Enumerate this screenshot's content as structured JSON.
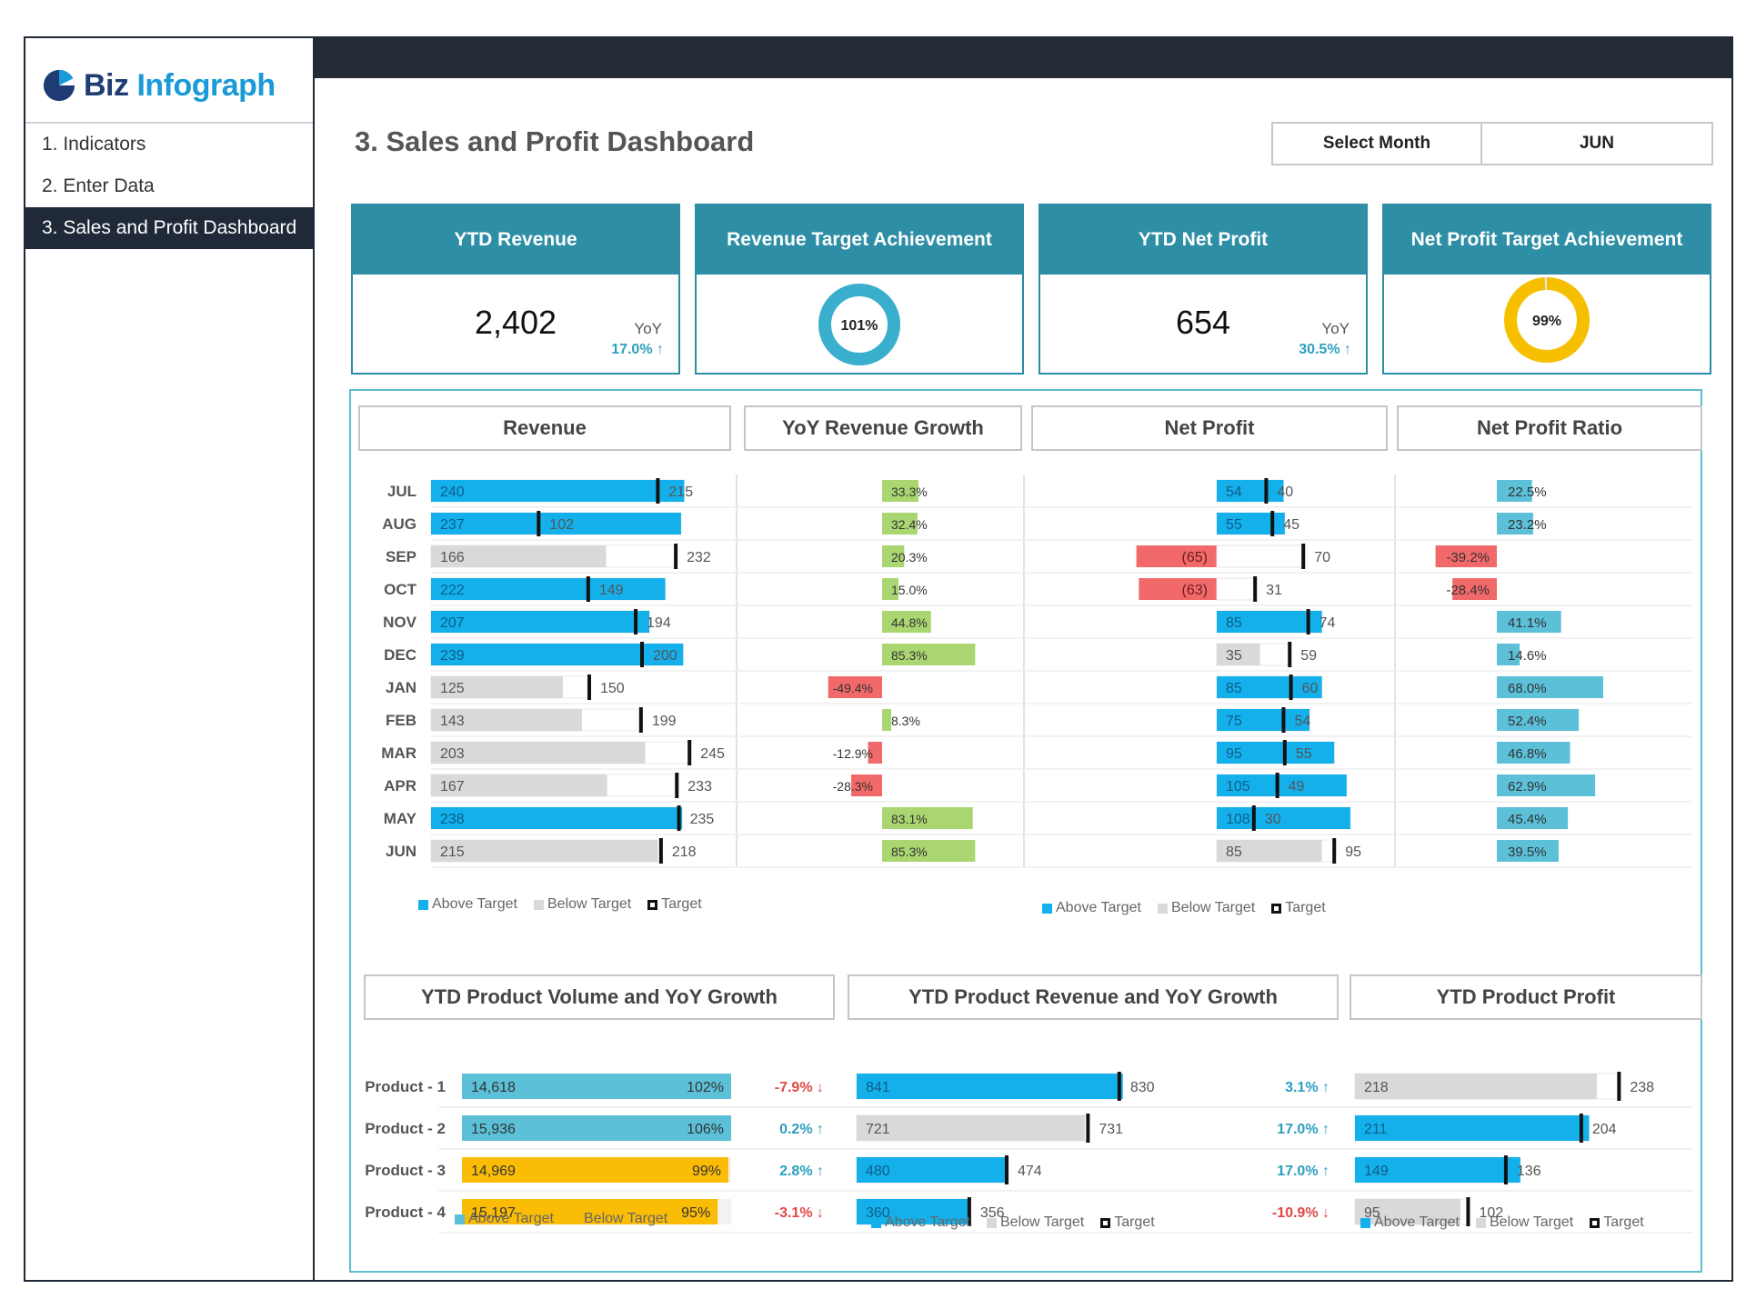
{
  "brand": {
    "biz": "Biz",
    "infograph": "Infograph"
  },
  "sidebar": {
    "items": [
      {
        "label": "1. Indicators",
        "active": false
      },
      {
        "label": "2. Enter Data",
        "active": false
      },
      {
        "label": "3. Sales and Profit Dashboard",
        "active": true
      }
    ]
  },
  "page": {
    "title": "3. Sales and Profit Dashboard"
  },
  "month_select": {
    "label": "Select Month",
    "value": "JUN"
  },
  "kpis": {
    "ytd_revenue": {
      "title": "YTD  Revenue",
      "value": "2,402",
      "yoy_label": "YoY",
      "yoy_value": "17.0% ↑"
    },
    "revenue_target": {
      "title": "Revenue Target Achievement",
      "value": "101%",
      "fraction": 1.0,
      "color": "#3aaecd"
    },
    "ytd_net_profit": {
      "title": "YTD  Net Profit",
      "value": "654",
      "yoy_label": "YoY",
      "yoy_value": "30.5% ↑"
    },
    "profit_target": {
      "title": "Net Profit Target Achievement",
      "value": "99%",
      "fraction": 0.99,
      "color": "#f6c000"
    }
  },
  "sections": {
    "revenue": "Revenue",
    "yoy_growth": "YoY Revenue Growth",
    "net_profit": "Net Profit",
    "net_profit_ratio": "Net Profit Ratio",
    "product_volume": "YTD Product Volume and YoY Growth",
    "product_revenue": "YTD Product Revenue and YoY Growth",
    "product_profit": "YTD Product Profit"
  },
  "legends": {
    "above": "Above Target",
    "below": "Below Target",
    "target": "Target"
  },
  "colors": {
    "above": "#14b0ec",
    "below": "#d9d9d9",
    "teal": "#5bc0d8",
    "yellow": "#fbbc05",
    "green": "#a9d670",
    "red": "#f2696a",
    "up": "#2c9fbf",
    "down": "#e04848"
  },
  "chart_data": [
    {
      "type": "bar",
      "name": "monthly",
      "categories": [
        "JUL",
        "AUG",
        "SEP",
        "OCT",
        "NOV",
        "DEC",
        "JAN",
        "FEB",
        "MAR",
        "APR",
        "MAY",
        "JUN"
      ],
      "revenue": [
        240,
        237,
        166,
        222,
        207,
        239,
        125,
        143,
        203,
        167,
        238,
        215
      ],
      "revenue_target": [
        215,
        102,
        232,
        149,
        194,
        200,
        150,
        199,
        245,
        233,
        235,
        218
      ],
      "revenue_yoy": [
        "33.3%",
        "32.4%",
        "20.3%",
        "15.0%",
        "44.8%",
        "85.3%",
        "-49.4%",
        "8.3%",
        "-12.9%",
        "-28.3%",
        "83.1%",
        "85.3%"
      ],
      "revenue_yoy_values": [
        33.3,
        32.4,
        20.3,
        15.0,
        44.8,
        85.3,
        -49.4,
        8.3,
        -12.9,
        -28.3,
        83.1,
        85.3
      ],
      "net_profit": [
        54,
        55,
        -65,
        -63,
        85,
        35,
        85,
        75,
        95,
        105,
        108,
        85
      ],
      "net_profit_labels": [
        "54",
        "55",
        "(65)",
        "(63)",
        "85",
        "35",
        "85",
        "75",
        "95",
        "105",
        "108",
        "85"
      ],
      "net_profit_target": [
        40,
        45,
        70,
        31,
        74,
        59,
        60,
        54,
        55,
        49,
        30,
        95
      ],
      "net_profit_ratio": [
        "22.5%",
        "23.2%",
        "-39.2%",
        "-28.4%",
        "41.1%",
        "14.6%",
        "68.0%",
        "52.4%",
        "46.8%",
        "62.9%",
        "45.4%",
        "39.5%"
      ],
      "net_profit_ratio_values": [
        22.5,
        23.2,
        -39.2,
        -28.4,
        41.1,
        14.6,
        68.0,
        52.4,
        46.8,
        62.9,
        45.4,
        39.5
      ]
    },
    {
      "type": "bar",
      "name": "products",
      "categories": [
        "Product - 1",
        "Product - 2",
        "Product - 3",
        "Product - 4"
      ],
      "volume": [
        "14,618",
        "15,936",
        "14,969",
        "15,197"
      ],
      "volume_achievement": [
        "102%",
        "106%",
        "99%",
        "95%"
      ],
      "volume_achievement_values": [
        102,
        106,
        99,
        95
      ],
      "volume_yoy": [
        "-7.9% ↓",
        "0.2% ↑",
        "2.8% ↑",
        "-3.1% ↓"
      ],
      "revenue": [
        841,
        721,
        480,
        360
      ],
      "revenue_target": [
        830,
        731,
        474,
        356
      ],
      "revenue_yoy": [
        "3.1% ↑",
        "17.0% ↑",
        "17.0% ↑",
        "-10.9% ↓"
      ],
      "profit": [
        218,
        211,
        149,
        95
      ],
      "profit_target": [
        238,
        204,
        136,
        102
      ]
    }
  ]
}
